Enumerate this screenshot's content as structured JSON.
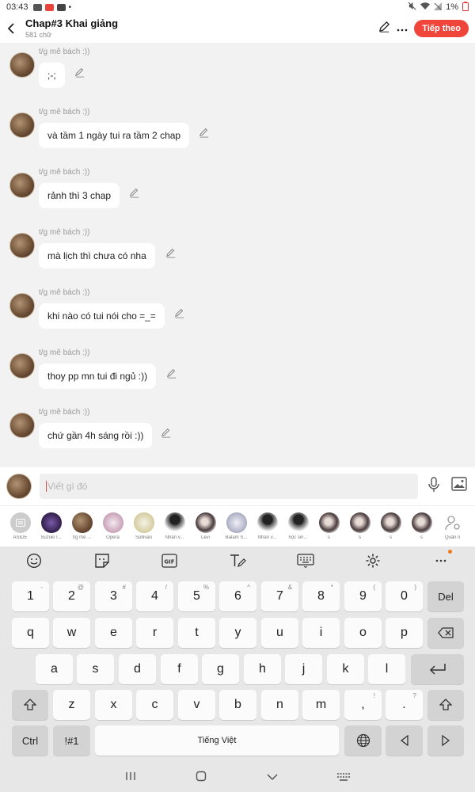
{
  "status_bar": {
    "time": "03:43",
    "battery": "1%"
  },
  "header": {
    "title": "Chap#3 Khai giảng",
    "subtitle": "581 chữ",
    "next_label": "Tiếp theo"
  },
  "messages": [
    {
      "author": "t/g mê bách :))",
      "text": ";-;"
    },
    {
      "author": "t/g mê bách :))",
      "text": "và tầm 1 ngày tui ra tầm 2 chap"
    },
    {
      "author": "t/g mê bách :))",
      "text": "rảnh thì 3 chap"
    },
    {
      "author": "t/g mê bách :))",
      "text": "mà lịch thì chưa có nha"
    },
    {
      "author": "t/g mê bách :))",
      "text": "khi nào có tui nói cho =_="
    },
    {
      "author": "t/g mê bách :))",
      "text": "thoy pp mn tui đi ngủ :))"
    },
    {
      "author": "t/g mê bách :))",
      "text": "chứ gần 4h sáng rồi :))"
    }
  ],
  "composer": {
    "placeholder": "Viết gì đó"
  },
  "mentions": [
    "ASIDE",
    "Suzuki I...",
    "t/g mê ...",
    "Opera",
    "Sullivan",
    "Nhân v...",
    "Levi",
    "Balam S...",
    "Nhân v...",
    "học sin...",
    "s",
    "s",
    "s",
    "s",
    "Quản lí"
  ],
  "keyboard": {
    "row1": [
      {
        "k": "1",
        "s": "-"
      },
      {
        "k": "2",
        "s": "@"
      },
      {
        "k": "3",
        "s": "#"
      },
      {
        "k": "4",
        "s": "/"
      },
      {
        "k": "5",
        "s": "%"
      },
      {
        "k": "6",
        "s": "^"
      },
      {
        "k": "7",
        "s": "&"
      },
      {
        "k": "8",
        "s": "*"
      },
      {
        "k": "9",
        "s": "("
      },
      {
        "k": "0",
        "s": ")"
      }
    ],
    "row2": [
      "q",
      "w",
      "e",
      "r",
      "t",
      "y",
      "u",
      "i",
      "o",
      "p"
    ],
    "row3": [
      "a",
      "s",
      "d",
      "f",
      "g",
      "h",
      "j",
      "k",
      "l"
    ],
    "row4": [
      "z",
      "x",
      "c",
      "v",
      "b",
      "n",
      "m"
    ],
    "del_label": "Del",
    "ctrl_label": "Ctrl",
    "sym_label": "!#1",
    "space_label": "Tiếng Việt",
    "comma": ",",
    "comma_sup": "!",
    "period": ".",
    "period_sup": "?"
  }
}
